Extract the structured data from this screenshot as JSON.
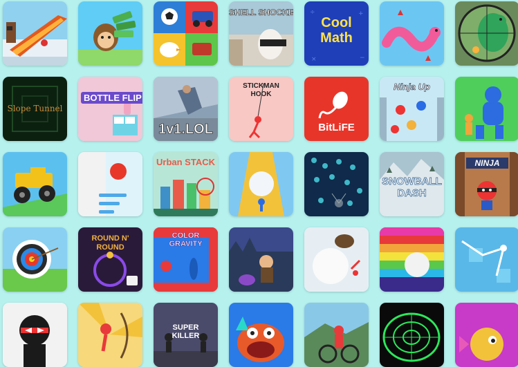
{
  "games": [
    {
      "id": "sled-ramp",
      "title": ""
    },
    {
      "id": "monkey-mart",
      "title": ""
    },
    {
      "id": "two-player-games",
      "title": ""
    },
    {
      "id": "shell-shockers",
      "title": "SHELL SHOCKERS"
    },
    {
      "id": "coolmath",
      "title": "Cool Math"
    },
    {
      "id": "snake-worm",
      "title": ""
    },
    {
      "id": "dino-sniper",
      "title": ""
    },
    {
      "id": "slope-tunnel",
      "title": "Slope Tunnel"
    },
    {
      "id": "bottle-flip",
      "title": "BOTTLE FLIP"
    },
    {
      "id": "1v1-lol",
      "title": "1v1.LOL"
    },
    {
      "id": "stickman-hook",
      "title": "STICKMAN HOOK"
    },
    {
      "id": "bitlife",
      "title": "BitLiFE"
    },
    {
      "id": "ninja-up",
      "title": "Ninja Up"
    },
    {
      "id": "stickman-smash",
      "title": ""
    },
    {
      "id": "monster-truck",
      "title": ""
    },
    {
      "id": "stack-ball",
      "title": ""
    },
    {
      "id": "urban-stack",
      "title": "Urban STACK"
    },
    {
      "id": "snowball-run",
      "title": ""
    },
    {
      "id": "bacteria",
      "title": ""
    },
    {
      "id": "snowball-dash",
      "title": "SNOWBALL DASH"
    },
    {
      "id": "ninja-climb",
      "title": "NINJA"
    },
    {
      "id": "archery",
      "title": ""
    },
    {
      "id": "round-n-round",
      "title": "ROUND N' ROUND"
    },
    {
      "id": "color-gravity",
      "title": "COLOR GRAVITY"
    },
    {
      "id": "ghost-run",
      "title": ""
    },
    {
      "id": "snowball-roll",
      "title": ""
    },
    {
      "id": "brick-breaker",
      "title": ""
    },
    {
      "id": "laser-puzzle",
      "title": ""
    },
    {
      "id": "ninja-stickman",
      "title": ""
    },
    {
      "id": "stickman-archer",
      "title": ""
    },
    {
      "id": "super-killer",
      "title": "SUPER KILLER"
    },
    {
      "id": "fish-eat",
      "title": ""
    },
    {
      "id": "bmx-rider",
      "title": ""
    },
    {
      "id": "neon-tunnel",
      "title": ""
    },
    {
      "id": "pink-fish",
      "title": ""
    }
  ]
}
